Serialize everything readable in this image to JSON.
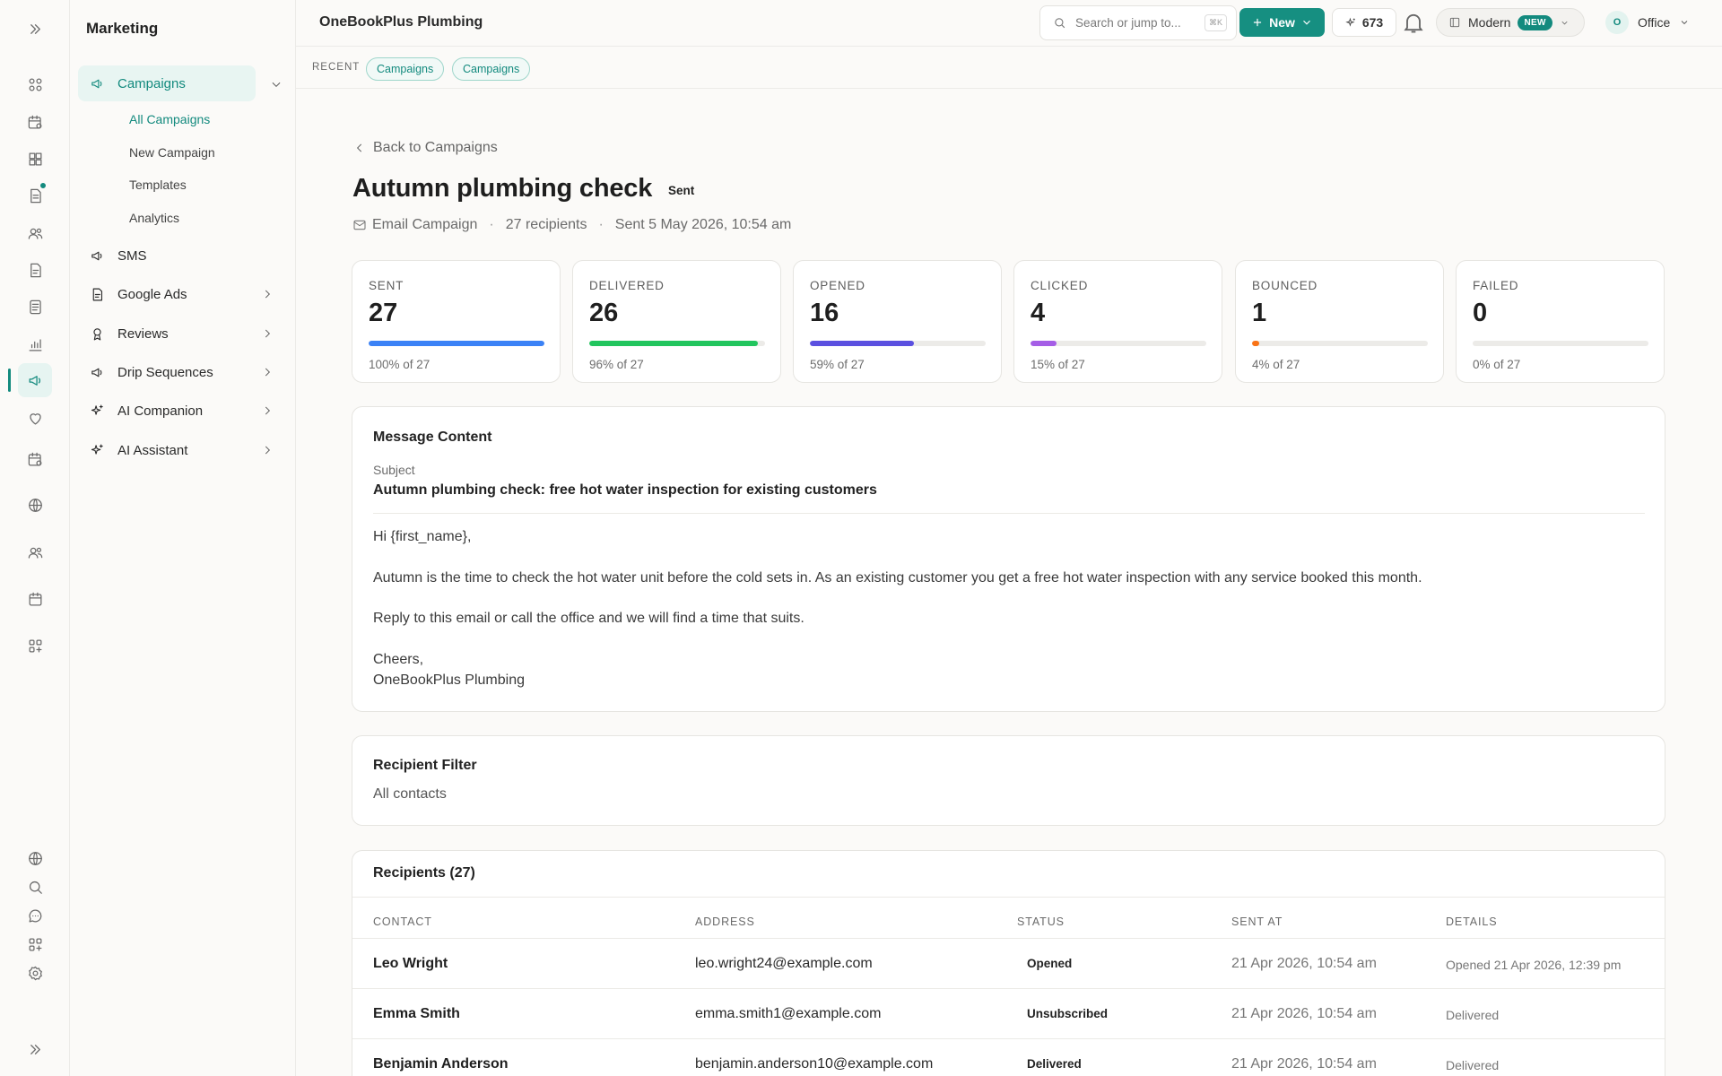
{
  "app": {
    "brand": "OneBookPlus Plumbing"
  },
  "topbar": {
    "search_placeholder": "Search or jump to...",
    "search_kbd": "⌘K",
    "new_label": "New",
    "credits": "673",
    "theme_label": "Modern",
    "theme_badge": "NEW",
    "office_initial": "O",
    "office_label": "Office"
  },
  "recent": {
    "label": "RECENT",
    "chips": [
      "Campaigns",
      "Campaigns"
    ]
  },
  "sidebar": {
    "section": "Marketing",
    "items": [
      {
        "label": "Campaigns",
        "icon": "megaphone-icon"
      },
      {
        "label": "SMS",
        "icon": "megaphone-icon"
      },
      {
        "label": "Google Ads",
        "icon": "document-icon"
      },
      {
        "label": "Reviews",
        "icon": "award-icon"
      },
      {
        "label": "Drip Sequences",
        "icon": "megaphone-icon"
      },
      {
        "label": "AI Companion",
        "icon": "sparkle-icon"
      },
      {
        "label": "AI Assistant",
        "icon": "sparkle-icon"
      }
    ],
    "subitems": [
      "All Campaigns",
      "New Campaign",
      "Templates",
      "Analytics"
    ]
  },
  "page": {
    "back_label": "Back to Campaigns",
    "title": "Autumn plumbing check",
    "status": "Sent",
    "meta_type": "Email Campaign",
    "meta_sep": "·",
    "meta_recipients": "27 recipients",
    "meta_sent": "Sent 5 May 2026, 10:54 am"
  },
  "stats": [
    {
      "label": "SENT",
      "value": "27",
      "pct_label": "100% of 27",
      "fraction": 1.0,
      "color": "#3b82f6"
    },
    {
      "label": "DELIVERED",
      "value": "26",
      "pct_label": "96% of 27",
      "fraction": 0.96,
      "color": "#22c55e"
    },
    {
      "label": "OPENED",
      "value": "16",
      "pct_label": "59% of 27",
      "fraction": 0.59,
      "color": "#5b50e0"
    },
    {
      "label": "CLICKED",
      "value": "4",
      "pct_label": "15% of 27",
      "fraction": 0.15,
      "color": "#a55ee6"
    },
    {
      "label": "BOUNCED",
      "value": "1",
      "pct_label": "4% of 27",
      "fraction": 0.04,
      "color": "#f97316"
    },
    {
      "label": "FAILED",
      "value": "0",
      "pct_label": "0% of 27",
      "fraction": 0.0,
      "color": "#ef4444"
    }
  ],
  "message": {
    "heading": "Message Content",
    "subject_label": "Subject",
    "subject": "Autumn plumbing check: free hot water inspection for existing customers",
    "body": [
      "Hi {first_name},",
      "Autumn is the time to check the hot water unit before the cold sets in. As an existing customer you get a free hot water inspection with any service booked this month.",
      "Reply to this email or call the office and we will find a time that suits.",
      "Cheers,",
      "OneBookPlus Plumbing"
    ]
  },
  "filter": {
    "heading": "Recipient Filter",
    "value": "All contacts"
  },
  "recipients": {
    "heading": "Recipients (27)",
    "columns": [
      "CONTACT",
      "ADDRESS",
      "STATUS",
      "SENT AT",
      "DETAILS"
    ],
    "rows": [
      {
        "contact": "Leo Wright",
        "address": "leo.wright24@example.com",
        "status": "Opened",
        "sent_at": "21 Apr 2026, 10:54 am",
        "details": "Opened 21 Apr 2026, 12:39 pm"
      },
      {
        "contact": "Emma Smith",
        "address": "emma.smith1@example.com",
        "status": "Unsubscribed",
        "sent_at": "21 Apr 2026, 10:54 am",
        "details": "Delivered"
      },
      {
        "contact": "Benjamin Anderson",
        "address": "benjamin.anderson10@example.com",
        "status": "Delivered",
        "sent_at": "21 Apr 2026, 10:54 am",
        "details": "Delivered"
      }
    ]
  }
}
